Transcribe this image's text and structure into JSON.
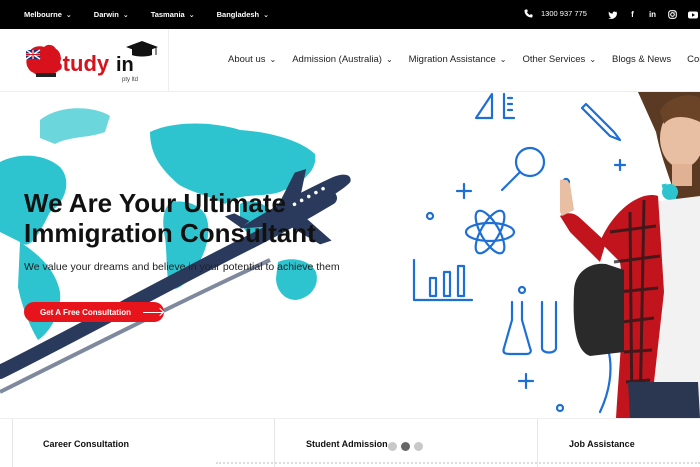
{
  "topbar": {
    "locations": [
      "Melbourne",
      "Darwin",
      "Tasmania",
      "Bangladesh"
    ],
    "phone": "1300 937 775",
    "socials": [
      "twitter-icon",
      "facebook-icon",
      "linkedin-icon",
      "instagram-icon",
      "youtube-icon"
    ]
  },
  "header": {
    "logo_text_a": "Study",
    "logo_text_b": "in",
    "logo_tagline": "pty ltd",
    "nav": [
      {
        "label": "About us",
        "dropdown": true
      },
      {
        "label": "Admission (Australia)",
        "dropdown": true
      },
      {
        "label": "Migration Assistance",
        "dropdown": true
      },
      {
        "label": "Other Services",
        "dropdown": true
      },
      {
        "label": "Blogs & News",
        "dropdown": false
      },
      {
        "label": "Contact",
        "dropdown": false
      }
    ]
  },
  "hero": {
    "title_line1": "We Are Your Ultimate",
    "title_line2": "Immigration Consultant",
    "subtitle": "We value your dreams and believe in your potential to achieve them",
    "cta_label": "Get A Free Consultation"
  },
  "services": {
    "items": [
      "Career Consultation",
      "Student Admission",
      "Job Assistance"
    ]
  },
  "carousel": {
    "count": 3,
    "active": 1
  },
  "colors": {
    "accent": "#e8141b",
    "map": "#2ec4cf",
    "navy": "#2a3a5c",
    "icon_blue": "#1d6fd6"
  }
}
